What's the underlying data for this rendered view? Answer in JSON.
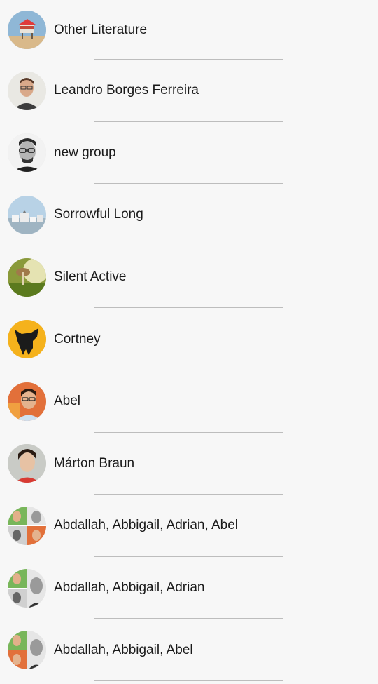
{
  "contacts": [
    {
      "name": "Other Literature",
      "avatar": "lifeguard-tower-photo"
    },
    {
      "name": "Leandro Borges Ferreira",
      "avatar": "person-photo"
    },
    {
      "name": "new group",
      "avatar": "person-glasses-bw-photo"
    },
    {
      "name": "Sorrowful Long",
      "avatar": "town-photo"
    },
    {
      "name": "Silent Active",
      "avatar": "mushroom-photo"
    },
    {
      "name": "Cortney",
      "avatar": "dog-silhouette"
    },
    {
      "name": "Abel",
      "avatar": "person-photo"
    },
    {
      "name": "Márton Braun",
      "avatar": "person-photo"
    },
    {
      "name": "Abdallah, Abbigail, Adrian, Abel",
      "avatar": "group-collage"
    },
    {
      "name": "Abdallah, Abbigail, Adrian",
      "avatar": "group-collage"
    },
    {
      "name": "Abdallah, Abbigail, Abel",
      "avatar": "group-collage"
    }
  ]
}
